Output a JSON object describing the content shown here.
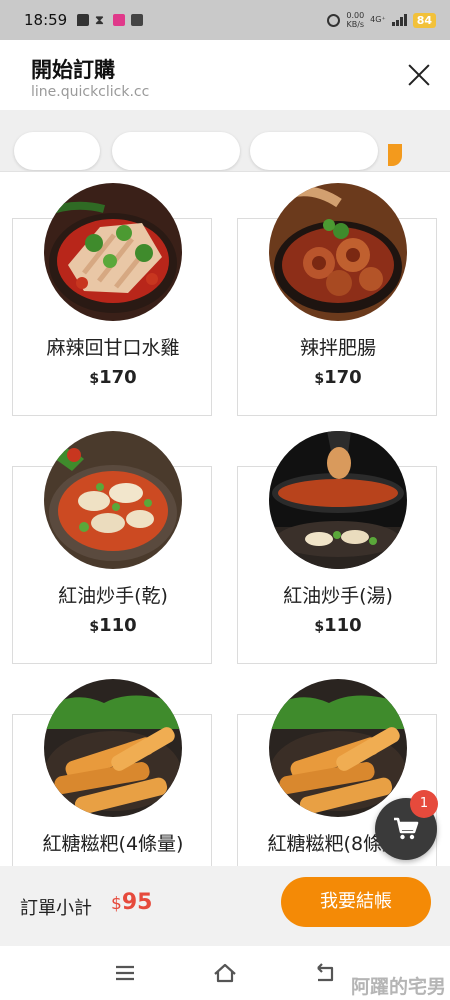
{
  "status_bar": {
    "time": "18:59",
    "net_speed_top": "0.00",
    "net_speed_bottom": "KB/s",
    "network": "4G⁺",
    "battery": "84"
  },
  "header": {
    "title": "開始訂購",
    "url": "line.quickclick.cc"
  },
  "menu": {
    "currency_symbol": "$",
    "items": [
      {
        "name": "麻辣回甘口水雞",
        "price": "170"
      },
      {
        "name": "辣拌肥腸",
        "price": "170"
      },
      {
        "name": "紅油炒手(乾)",
        "price": "110"
      },
      {
        "name": "紅油炒手(湯)",
        "price": "110"
      },
      {
        "name": "紅糖糍粑(4條量)",
        "price": ""
      },
      {
        "name": "紅糖糍粑(8條量)",
        "price": ""
      }
    ]
  },
  "cart": {
    "badge_count": "1"
  },
  "order": {
    "subtotal_label": "訂單小計",
    "currency_symbol": "$",
    "subtotal_value": "95",
    "checkout_label": "我要結帳"
  },
  "watermark": "阿躍的宅男",
  "colors": {
    "accent_orange": "#f48a06",
    "price_red": "#e64a3c",
    "cart_dark": "#3a3a3a"
  }
}
